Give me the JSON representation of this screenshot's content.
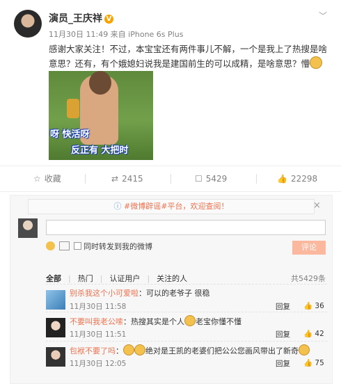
{
  "post": {
    "author": "演员_王庆祥",
    "verified_badge": "V",
    "meta": "11月30日 11:49 来自 iPhone 6s Plus",
    "more_icon": "chevron-down-icon",
    "text": "感谢大家关注！不过，本宝宝还有两件事儿不解，一个是我上了热搜是啥意思？还有，有个娥媳妇说我是建国前生的可以成精，是啥意思？懵",
    "gif_captions": [
      "呀 快活呀",
      "反正有 大把时"
    ]
  },
  "actions": {
    "favorite": "收藏",
    "repost": "2415",
    "comment": "5429",
    "like": "22298"
  },
  "notice": {
    "prefix": "#微博辟谣#平台，欢迎查阅！",
    "close": "×"
  },
  "composer": {
    "placeholder": "",
    "repost_label": "同时转发到我的微博",
    "submit": "评论"
  },
  "filters": {
    "items": [
      "全部",
      "热门",
      "认证用户",
      "关注的人"
    ],
    "total": "共5429条"
  },
  "comments": [
    {
      "nick": "别杀我这个小可爱啦",
      "text": "：可以的老爷子 很稳",
      "time": "11月30日 11:58",
      "reply": "回复",
      "likes": "36"
    },
    {
      "nick": "不要叫我老公嗦",
      "text": "：热搜其实是个人",
      "text2": "老宝你懂不懂",
      "time": "11月30日 11:51",
      "reply": "回复",
      "likes": "42"
    },
    {
      "nick": "包袱不要了吗",
      "text": "：",
      "text2": "绝对是王凯的老婆们把公公您画风带出了新奇",
      "time": "11月30日 12:05",
      "reply": "回复",
      "likes": "75"
    }
  ],
  "colors": {
    "accent": "#eb7350",
    "badge": "#f7a400",
    "submit": "#fcb79f"
  }
}
